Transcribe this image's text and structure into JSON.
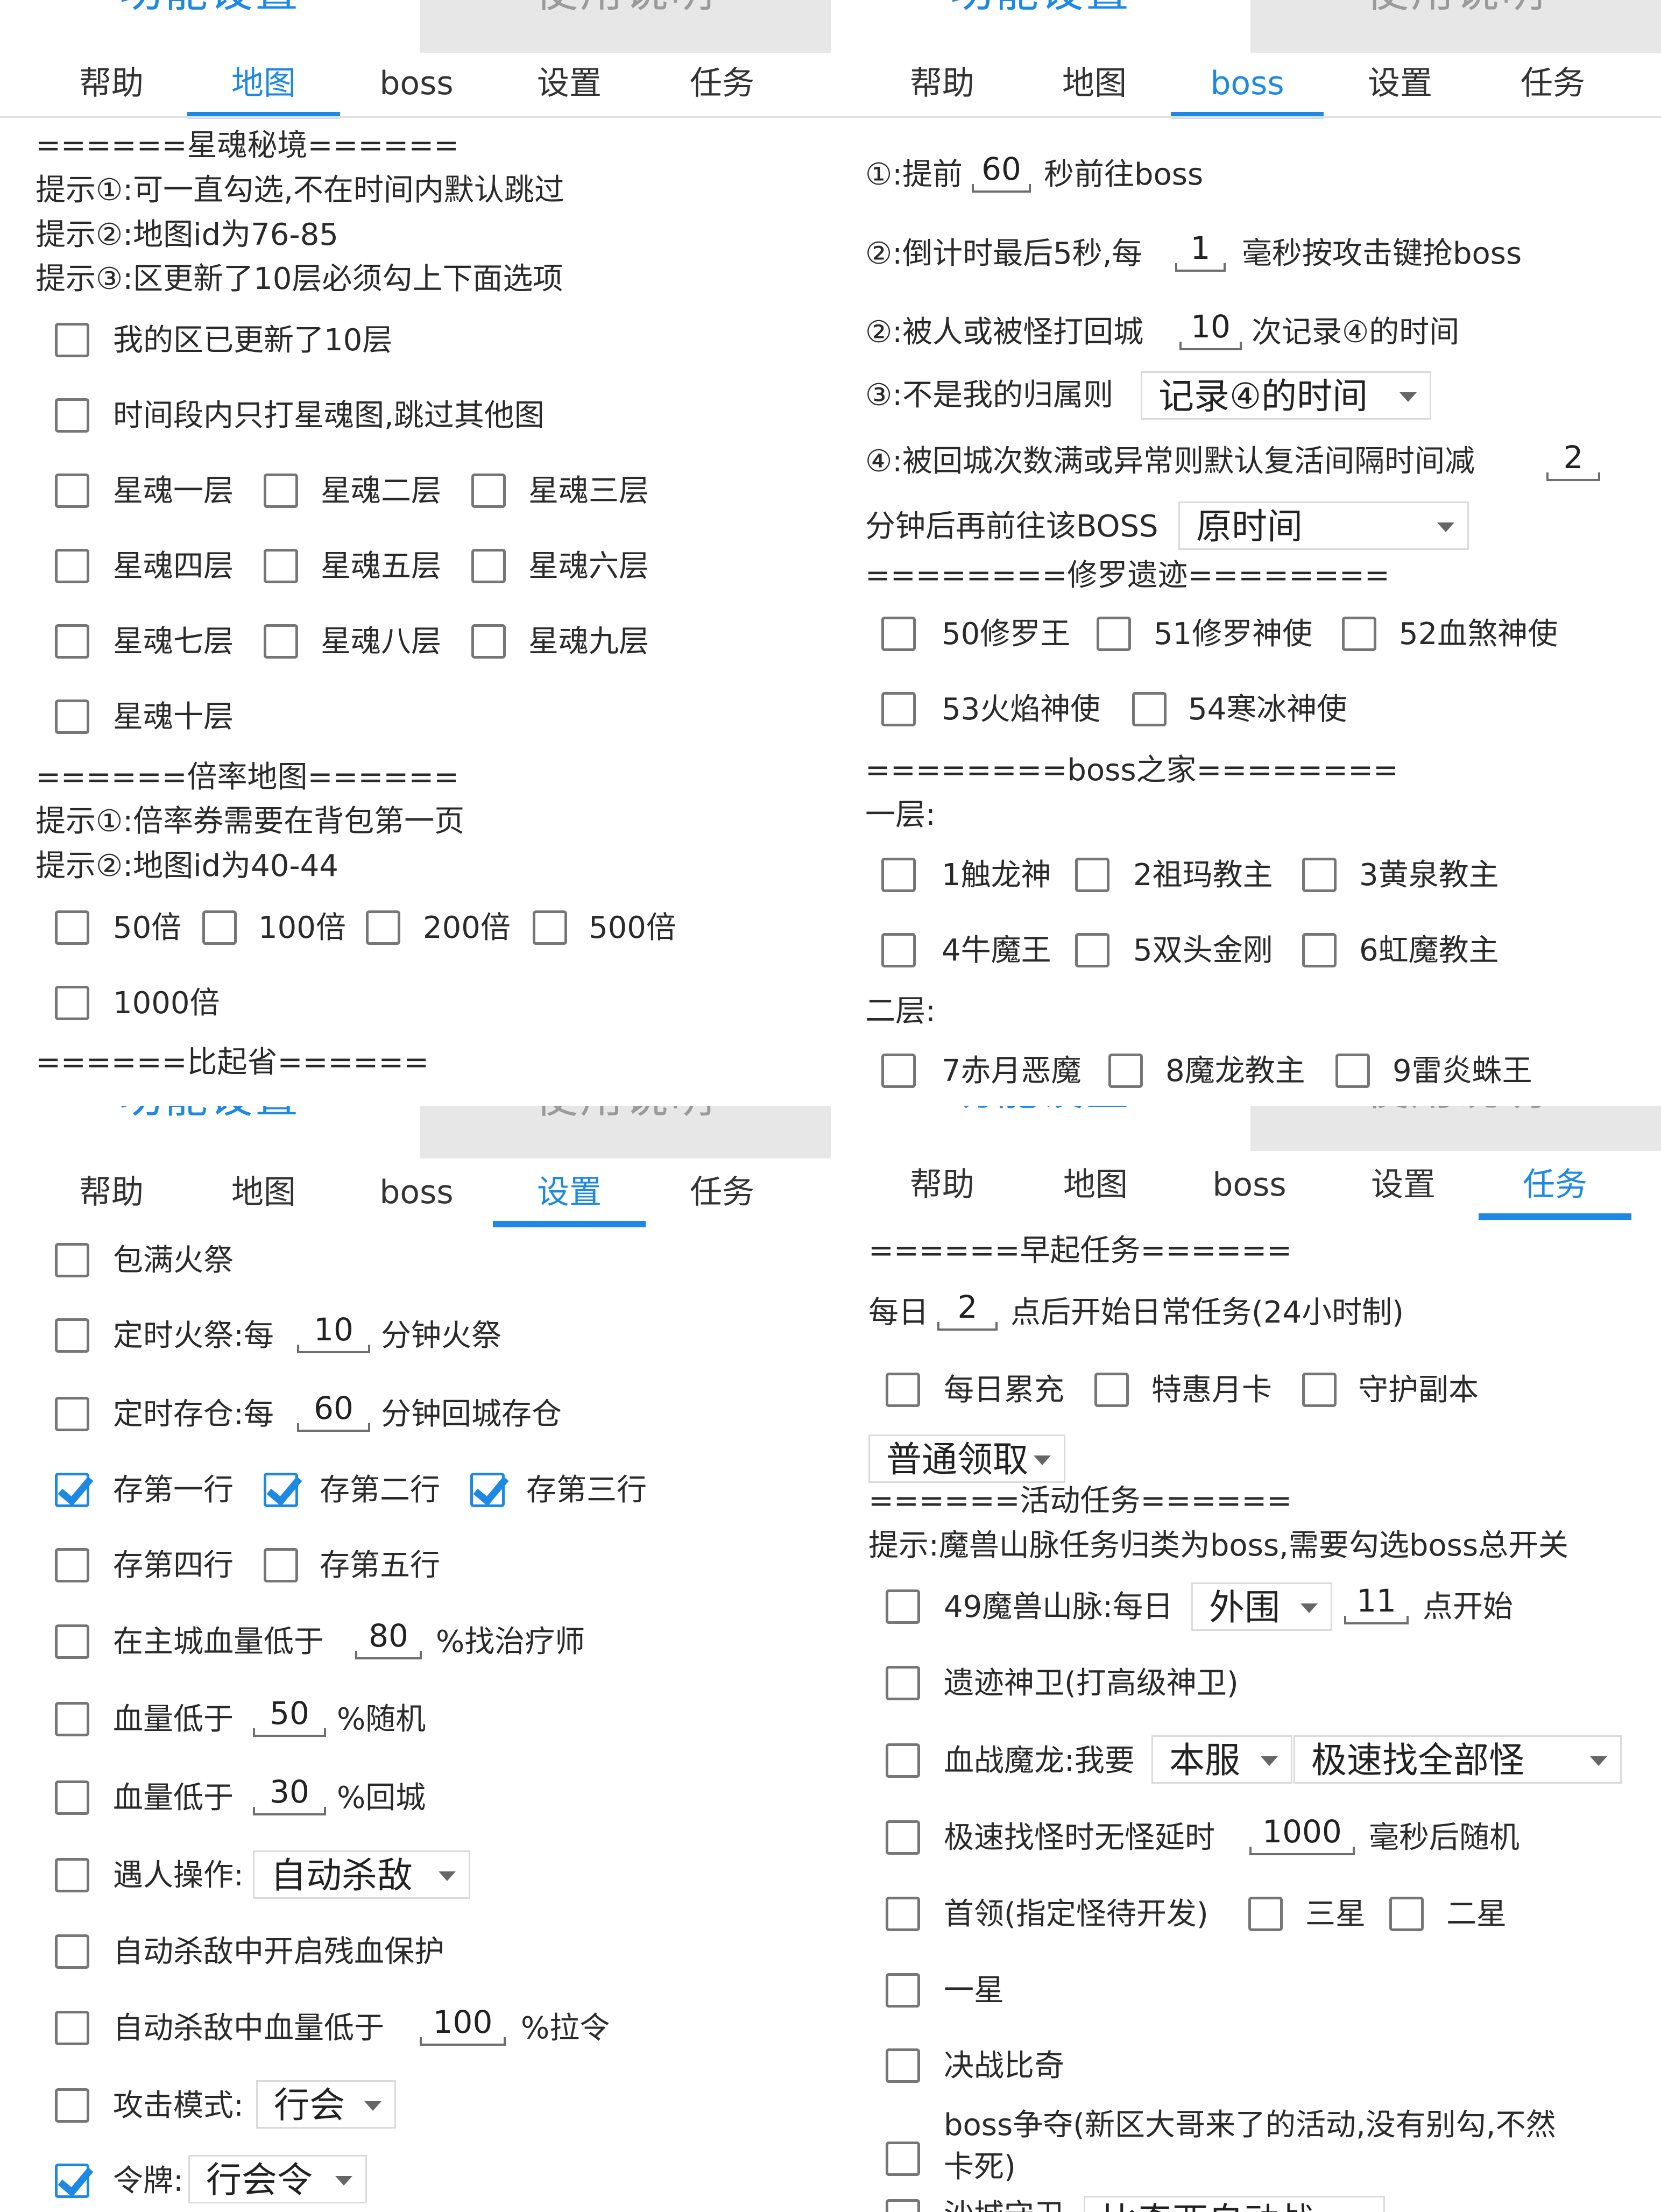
{
  "top_tabs": {
    "func": "功能设置",
    "guide": "使用说明"
  },
  "subtabs": [
    "帮助",
    "地图",
    "boss",
    "设置",
    "任务"
  ],
  "map": {
    "xinghun_header": "======星魂秘境======",
    "tip1": "提示①:可一直勾选,不在时间内默认跳过",
    "tip2": "提示②:地图id为76-85",
    "tip3": "提示③:区更新了10层必须勾上下面选项",
    "updated10": "我的区已更新了10层",
    "only_xinghun": "时间段内只打星魂图,跳过其他图",
    "layers": [
      "星魂一层",
      "星魂二层",
      "星魂三层",
      "星魂四层",
      "星魂五层",
      "星魂六层",
      "星魂七层",
      "星魂八层",
      "星魂九层",
      "星魂十层"
    ],
    "beilv_header": "======倍率地图======",
    "btip1": "提示①:倍率券需要在背包第一页",
    "btip2": "提示②:地图id为40-44",
    "multipliers": [
      "50倍",
      "100倍",
      "200倍",
      "500倍",
      "1000倍"
    ],
    "biqi_header": "======比起省======"
  },
  "boss": {
    "l1a": "①:提前",
    "l1v": "60",
    "l1b": "秒前往boss",
    "l2a": "②:倒计时最后5秒,每",
    "l2v": "1",
    "l2b": "毫秒按攻击键抢boss",
    "l3a": "②:被人或被怪打回城",
    "l3v": "10",
    "l3b": "次记录④的时间",
    "l4a": "③:不是我的归属则",
    "l4sel": "记录④的时间",
    "l5a": "④:被回城次数满或异常则默认复活间隔时间减",
    "l5v": "2",
    "l6a": "分钟后再前往该BOSS",
    "l6sel": "原时间",
    "xiuluo_header": "========修罗遗迹========",
    "xiuluo": [
      "50修罗王",
      "51修罗神使",
      "52血煞神使",
      "53火焰神使",
      "54寒冰神使"
    ],
    "home_header": "========boss之家========",
    "floor1": "一层:",
    "f1": [
      "1触龙神",
      "2祖玛教主",
      "3黄泉教主",
      "4牛魔王",
      "5双头金刚",
      "6虹魔教主"
    ],
    "floor2": "二层:",
    "f2": [
      "7赤月恶魔",
      "8魔龙教主",
      "9雷炎蛛王"
    ]
  },
  "settings": {
    "baoman": "包满火祭",
    "dingshi_a": "定时火祭:每",
    "dingshi_v": "10",
    "dingshi_b": "分钟火祭",
    "cuncang_a": "定时存仓:每",
    "cuncang_v": "60",
    "cuncang_b": "分钟回城存仓",
    "rows": [
      "存第一行",
      "存第二行",
      "存第三行",
      "存第四行",
      "存第五行"
    ],
    "heal_a": "在主城血量低于",
    "heal_v": "80",
    "heal_b": "%找治疗师",
    "rand_a": "血量低于",
    "rand_v": "50",
    "rand_b": "%随机",
    "home_a": "血量低于",
    "home_v": "30",
    "home_b": "%回城",
    "meet": "遇人操作:",
    "meet_sel": "自动杀敌",
    "protect": "自动杀敌中开启残血保护",
    "pull_a": "自动杀敌中血量低于",
    "pull_v": "100",
    "pull_b": "%拉令",
    "mode": "攻击模式:",
    "mode_sel": "行会",
    "token": "令牌:",
    "token_sel": "行会令"
  },
  "tasks": {
    "early_header": "======早起任务======",
    "daily_a": "每日",
    "daily_v": "2",
    "daily_b": "点后开始日常任务(24小时制)",
    "daily_items": [
      "每日累充",
      "特惠月卡",
      "守护副本"
    ],
    "claim_sel": "普通领取",
    "act_header": "======活动任务======",
    "act_tip": "提示:魔兽山脉任务归类为boss,需要勾选boss总开关",
    "mountain_a": "49魔兽山脉:每日",
    "mountain_sel": "外围",
    "mountain_v": "11",
    "mountain_b": "点开始",
    "relic": "遗迹神卫(打高级神卫)",
    "dragon_a": "血战魔龙:我要",
    "dragon_sel1": "本服",
    "dragon_sel2": "极速找全部怪",
    "fast_a": "极速找怪时无怪延时",
    "fast_v": "1000",
    "fast_b": "毫秒后随机",
    "leader": "首领(指定怪待开发)",
    "star3": "三星",
    "star2": "二星",
    "star1": "一星",
    "duel": "决战比奇",
    "fight_l1": "boss争夺(新区大哥来了的活动,没有别勾,不然",
    "fight_l2": "卡死)",
    "last_a": "沙城守卫",
    "last_sel": "比奇西自动战"
  },
  "colors": {
    "accent": "#1e88e5",
    "tab_inactive_bg": "#e7e7e7"
  }
}
